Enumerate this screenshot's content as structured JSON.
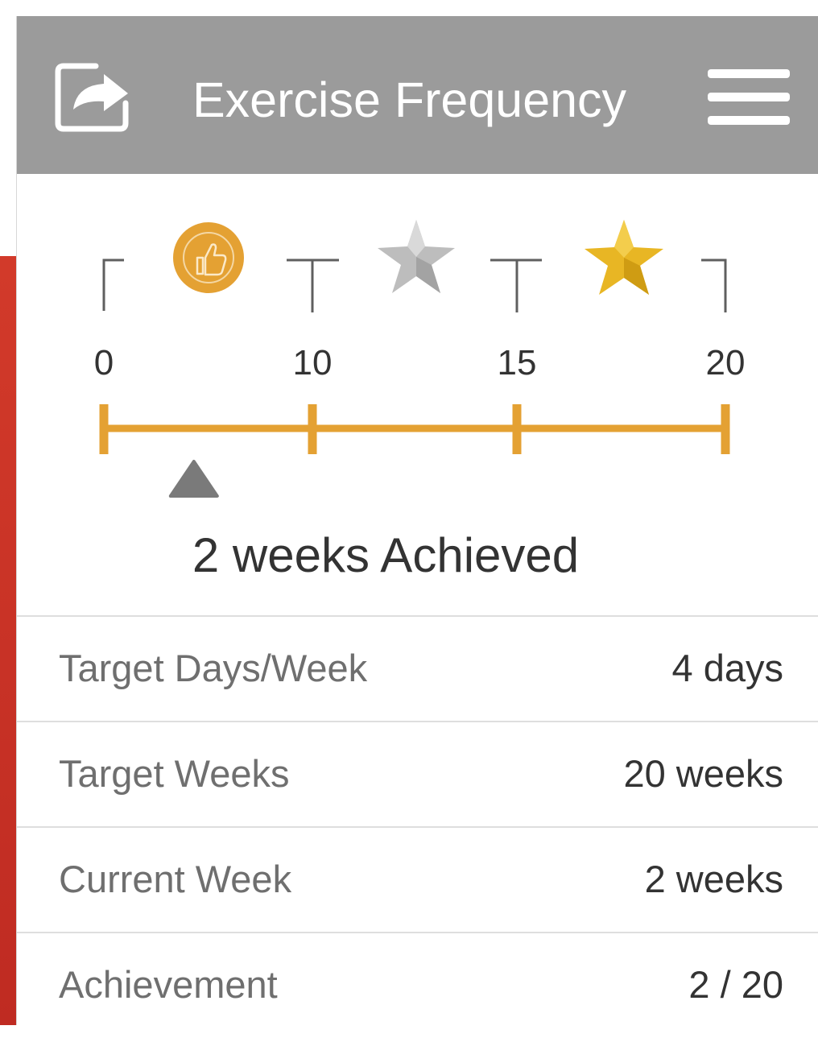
{
  "header": {
    "title": "Exercise Frequency",
    "share_icon": "share-icon",
    "menu_icon": "hamburger-menu-icon"
  },
  "progress": {
    "ticks": [
      "0",
      "10",
      "15",
      "20"
    ],
    "milestones": [
      {
        "at": "0-10",
        "badge": "thumbs-up-badge-icon"
      },
      {
        "at": "10-15",
        "badge": "silver-star-icon"
      },
      {
        "at": "15-20",
        "badge": "gold-star-icon"
      }
    ],
    "current_weeks": 2,
    "max_weeks": 20,
    "achieved_text": "2 weeks Achieved",
    "colors": {
      "track": "#e4a133",
      "marker": "#7a7a7a",
      "silver": "#bdbdbd",
      "gold": "#e8b624"
    }
  },
  "stats": [
    {
      "label": "Target Days/Week",
      "value": "4 days"
    },
    {
      "label": "Target Weeks",
      "value": "20 weeks"
    },
    {
      "label": "Current Week",
      "value": "2 weeks"
    },
    {
      "label": "Achievement",
      "value": "2 / 20"
    }
  ]
}
